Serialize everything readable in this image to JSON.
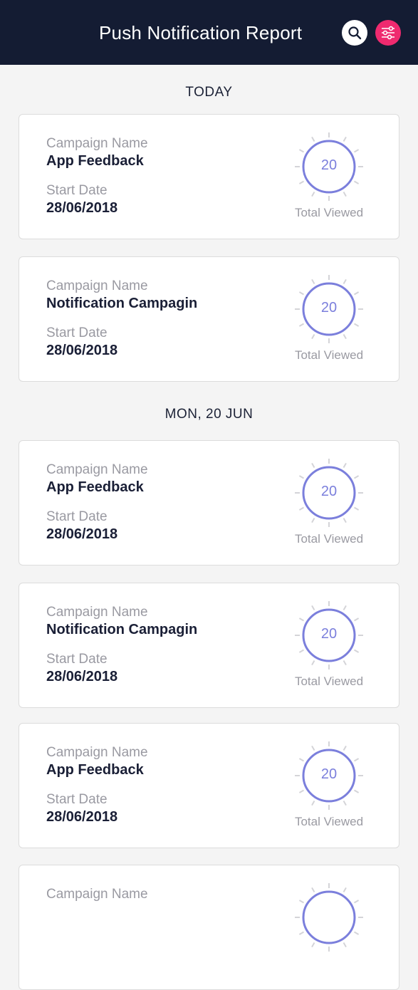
{
  "header": {
    "title": "Push Notification Report"
  },
  "sections": [
    {
      "label": "TODAY"
    },
    {
      "label": "MON, 20 JUN"
    }
  ],
  "cards": [
    {
      "campaign_label": "Campaign Name",
      "campaign_name": "App Feedback",
      "date_label": "Start Date",
      "start_date": "28/06/2018",
      "viewed_count": "20",
      "viewed_label": "Total Viewed"
    },
    {
      "campaign_label": "Campaign Name",
      "campaign_name": "Notification Campagin",
      "date_label": "Start Date",
      "start_date": "28/06/2018",
      "viewed_count": "20",
      "viewed_label": "Total Viewed"
    },
    {
      "campaign_label": "Campaign Name",
      "campaign_name": "App Feedback",
      "date_label": "Start Date",
      "start_date": "28/06/2018",
      "viewed_count": "20",
      "viewed_label": "Total Viewed"
    },
    {
      "campaign_label": "Campaign Name",
      "campaign_name": "Notification Campagin",
      "date_label": "Start Date",
      "start_date": "28/06/2018",
      "viewed_count": "20",
      "viewed_label": "Total Viewed"
    },
    {
      "campaign_label": "Campaign Name",
      "campaign_name": "App Feedback",
      "date_label": "Start Date",
      "start_date": "28/06/2018",
      "viewed_count": "20",
      "viewed_label": "Total Viewed"
    },
    {
      "campaign_label": "Campaign Name"
    }
  ],
  "colors": {
    "header_bg": "#141c33",
    "accent_pink": "#ef2a6f",
    "gauge_ring": "#7b7fdc"
  },
  "icons": [
    "search-icon",
    "filter-icon"
  ]
}
